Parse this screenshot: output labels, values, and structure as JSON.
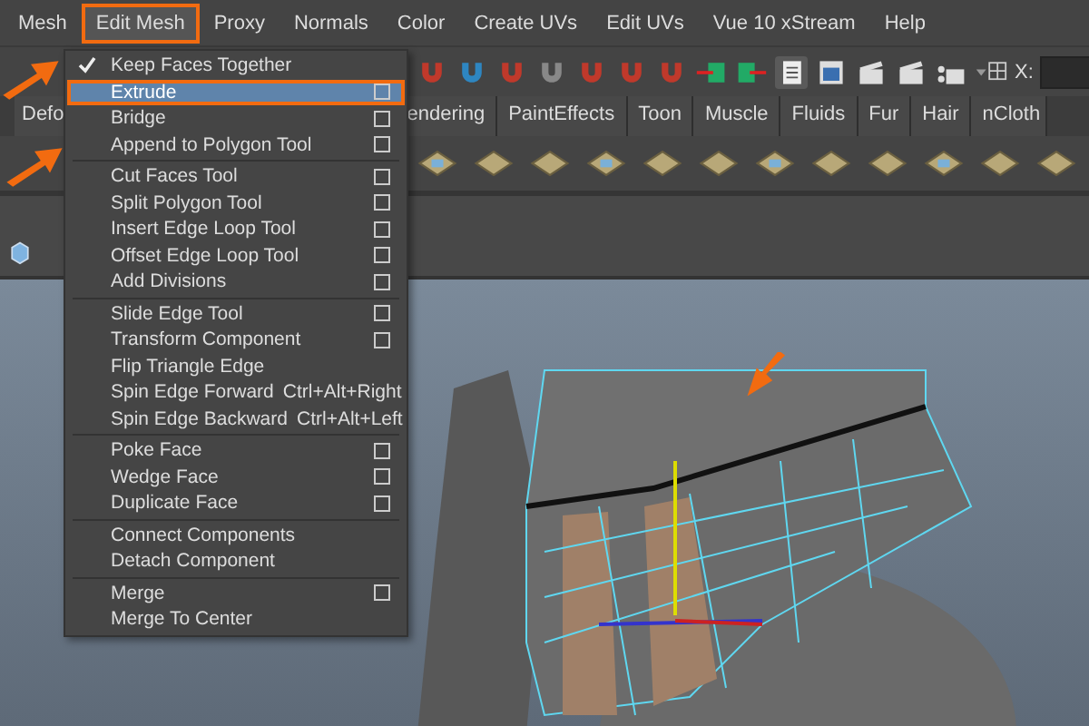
{
  "menubar": [
    {
      "label": "Mesh",
      "selected": false
    },
    {
      "label": "Edit Mesh",
      "selected": true
    },
    {
      "label": "Proxy",
      "selected": false
    },
    {
      "label": "Normals",
      "selected": false
    },
    {
      "label": "Color",
      "selected": false
    },
    {
      "label": "Create UVs",
      "selected": false
    },
    {
      "label": "Edit UVs",
      "selected": false
    },
    {
      "label": "Vue 10 xStream",
      "selected": false
    },
    {
      "label": "Help",
      "selected": false
    }
  ],
  "toolbar": {
    "coordinate_label": "X:"
  },
  "shelf_tabs": [
    {
      "label": "Defo",
      "selected": false
    },
    {
      "label": "endering",
      "selected": false
    },
    {
      "label": "PaintEffects",
      "selected": false
    },
    {
      "label": "Toon",
      "selected": false
    },
    {
      "label": "Muscle",
      "selected": false
    },
    {
      "label": "Fluids",
      "selected": false
    },
    {
      "label": "Fur",
      "selected": false
    },
    {
      "label": "Hair",
      "selected": false
    },
    {
      "label": "nCloth",
      "selected": false
    }
  ],
  "menu": [
    {
      "kind": "check",
      "label": "Keep Faces Together",
      "checked": true
    },
    {
      "kind": "item",
      "label": "Extrude",
      "options": true,
      "selected": true
    },
    {
      "kind": "item",
      "label": "Bridge",
      "options": true,
      "selected": false
    },
    {
      "kind": "item",
      "label": "Append to Polygon Tool",
      "options": true,
      "selected": false
    },
    {
      "kind": "separator"
    },
    {
      "kind": "item",
      "label": "Cut Faces Tool",
      "options": true,
      "selected": false
    },
    {
      "kind": "item",
      "label": "Split Polygon Tool",
      "options": true,
      "selected": false
    },
    {
      "kind": "item",
      "label": "Insert Edge Loop Tool",
      "options": true,
      "selected": false
    },
    {
      "kind": "item",
      "label": "Offset Edge Loop Tool",
      "options": true,
      "selected": false
    },
    {
      "kind": "item",
      "label": "Add Divisions",
      "options": true,
      "selected": false
    },
    {
      "kind": "separator"
    },
    {
      "kind": "item",
      "label": "Slide Edge Tool",
      "options": true,
      "selected": false
    },
    {
      "kind": "item",
      "label": "Transform Component",
      "options": true,
      "selected": false
    },
    {
      "kind": "item",
      "label": "Flip Triangle Edge",
      "options": false,
      "selected": false
    },
    {
      "kind": "item",
      "label": "Spin Edge Forward",
      "shortcut": "Ctrl+Alt+Right",
      "options": false,
      "selected": false
    },
    {
      "kind": "item",
      "label": "Spin Edge Backward",
      "shortcut": "Ctrl+Alt+Left",
      "options": false,
      "selected": false
    },
    {
      "kind": "separator"
    },
    {
      "kind": "item",
      "label": "Poke Face",
      "options": true,
      "selected": false
    },
    {
      "kind": "item",
      "label": "Wedge Face",
      "options": true,
      "selected": false
    },
    {
      "kind": "item",
      "label": "Duplicate Face",
      "options": true,
      "selected": false
    },
    {
      "kind": "separator"
    },
    {
      "kind": "item",
      "label": "Connect Components",
      "options": false,
      "selected": false
    },
    {
      "kind": "item",
      "label": "Detach Component",
      "options": false,
      "selected": false
    },
    {
      "kind": "separator"
    },
    {
      "kind": "item",
      "label": "Merge",
      "options": true,
      "selected": false
    },
    {
      "kind": "item",
      "label": "Merge To Center",
      "options": false,
      "selected": false
    }
  ]
}
